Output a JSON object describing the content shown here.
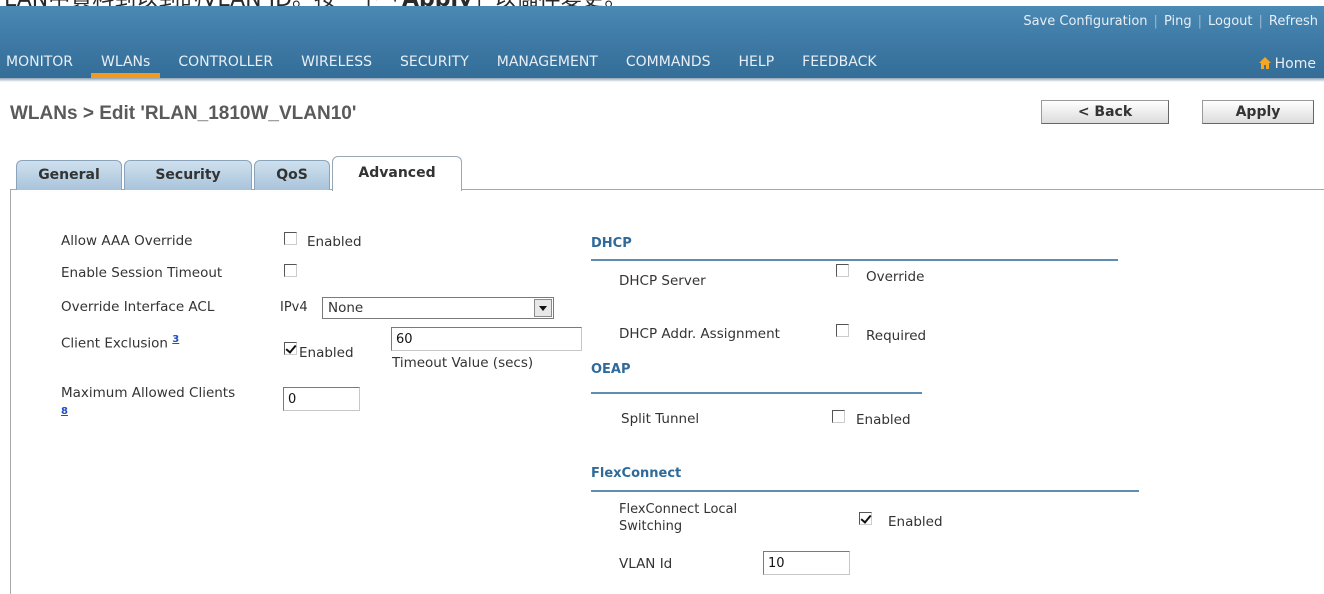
{
  "caption": {
    "text_before": "LAN中資料到以到的VLAN ID。按一下「",
    "bold": "Apply",
    "text_after": "」以儲存變更。"
  },
  "header": {
    "util_links": [
      "Save Configuration",
      "Ping",
      "Logout",
      "Refresh"
    ],
    "nav": [
      "MONITOR",
      "WLANs",
      "CONTROLLER",
      "WIRELESS",
      "SECURITY",
      "MANAGEMENT",
      "COMMANDS",
      "HELP",
      "FEEDBACK"
    ],
    "active_nav": "WLANs",
    "home_label": "Home",
    "accent_color": "#f39a1e"
  },
  "page": {
    "title": "WLANs > Edit  'RLAN_1810W_VLAN10'",
    "back_label": "< Back",
    "apply_label": "Apply"
  },
  "tabs": [
    {
      "label": "General"
    },
    {
      "label": "Security"
    },
    {
      "label": "QoS"
    },
    {
      "label": "Advanced"
    }
  ],
  "active_tab": "Advanced",
  "left": {
    "aaa_label": "Allow AAA Override",
    "aaa_cb_label": "Enabled",
    "aaa_checked": false,
    "session_label": "Enable Session Timeout",
    "session_checked": false,
    "acl_label": "Override Interface ACL",
    "acl_prefix": "IPv4",
    "acl_value": "None",
    "exclusion_label": "Client Exclusion",
    "exclusion_ref": "3",
    "exclusion_cb_label": "Enabled",
    "exclusion_checked": true,
    "timeout_value": "60",
    "timeout_label": "Timeout Value (secs)",
    "max_clients_label": "Maximum Allowed Clients",
    "max_clients_ref": "8",
    "max_clients_value": "0"
  },
  "right": {
    "dhcp_head": "DHCP",
    "dhcp_server_label": "DHCP Server",
    "dhcp_server_cb": "Override",
    "dhcp_server_checked": false,
    "dhcp_addr_label": "DHCP Addr. Assignment",
    "dhcp_addr_cb": "Required",
    "dhcp_addr_checked": false,
    "oeap_head": "OEAP",
    "split_label": "Split Tunnel",
    "split_cb": "Enabled",
    "split_checked": false,
    "flex_head": "FlexConnect",
    "flex_local_label_1": "FlexConnect Local",
    "flex_local_label_2": "Switching",
    "flex_local_cb": "Enabled",
    "flex_local_checked": true,
    "vlan_label": "VLAN Id",
    "vlan_value": "10"
  }
}
